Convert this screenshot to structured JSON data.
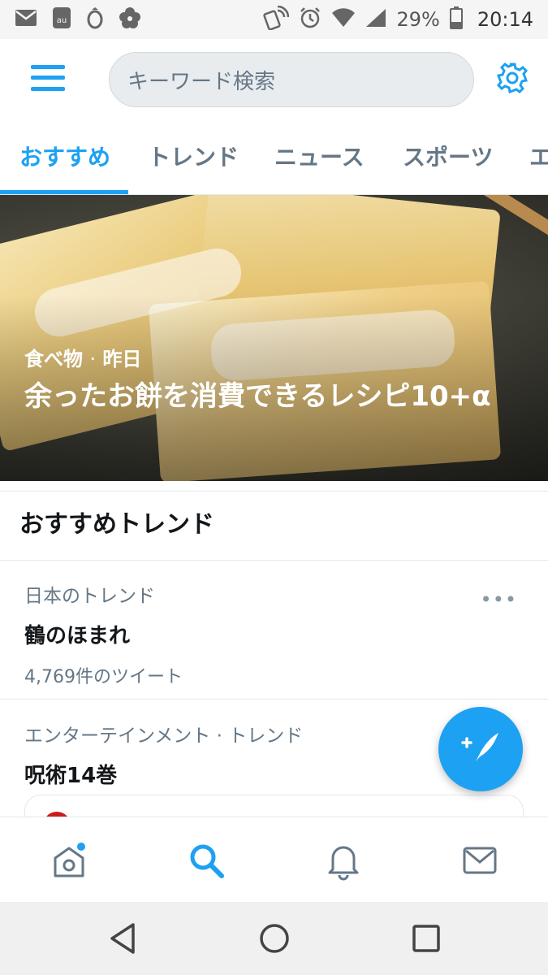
{
  "status_bar": {
    "battery": "29%",
    "time": "20:14",
    "icons": [
      "mail-icon",
      "au-icon",
      "ring-icon",
      "flower-icon",
      "nfc-icon",
      "alarm-icon",
      "wifi-icon",
      "signal-icon",
      "battery-icon"
    ]
  },
  "header": {
    "menu_icon": "hamburger-icon",
    "search_placeholder": "キーワード検索",
    "settings_icon": "gear-icon"
  },
  "tabs": [
    {
      "label": "おすすめ",
      "active": true
    },
    {
      "label": "トレンド",
      "active": false
    },
    {
      "label": "ニュース",
      "active": false
    },
    {
      "label": "スポーツ",
      "active": false
    },
    {
      "label": "エ",
      "active": false
    }
  ],
  "hero": {
    "category": "食べ物",
    "separator": "·",
    "time": "昨日",
    "title": "余ったお餅を消費できるレシピ10+α"
  },
  "section": {
    "title": "おすすめトレンド"
  },
  "trends": [
    {
      "category": "日本のトレンド",
      "name": "鶴のほまれ",
      "count": "4,769件のツイート",
      "more": "•••"
    },
    {
      "category": "エンターテインメント · トレンド",
      "name": "呪術14巻"
    }
  ],
  "fab": {
    "icon": "compose-tweet-icon"
  },
  "bottom_nav": [
    {
      "icon": "home-icon",
      "active": false,
      "has_dot": true
    },
    {
      "icon": "search-icon",
      "active": true
    },
    {
      "icon": "bell-icon",
      "active": false
    },
    {
      "icon": "mail-icon",
      "active": false
    }
  ],
  "system_nav": [
    "back-icon",
    "home-circle-icon",
    "recents-icon"
  ],
  "colors": {
    "accent": "#1da1f2",
    "text_primary": "#14171a",
    "text_secondary": "#657786",
    "divider": "#e1e8ed"
  }
}
